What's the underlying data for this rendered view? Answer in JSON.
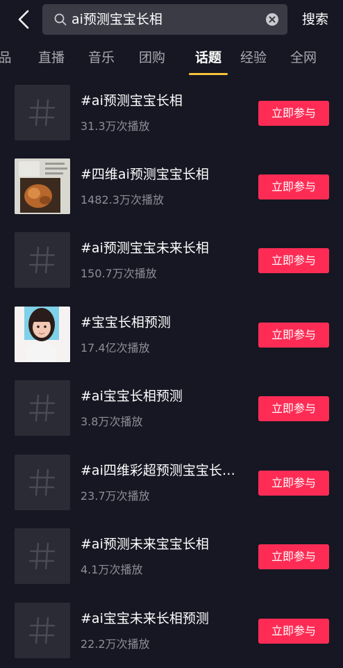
{
  "search": {
    "query": "ai预测宝宝长相",
    "submit_label": "搜索"
  },
  "tabs": [
    {
      "label": "品"
    },
    {
      "label": "直播"
    },
    {
      "label": "音乐"
    },
    {
      "label": "团购"
    },
    {
      "label": "话题",
      "active": true
    },
    {
      "label": "经验"
    },
    {
      "label": "全网"
    }
  ],
  "colors": {
    "accent": "#fe2c55",
    "tab_underline": "#f7c33d",
    "background": "#161722"
  },
  "results": [
    {
      "title": "#ai预测宝宝长相",
      "plays": "31.3万次播放",
      "thumb": "hashtag-icon",
      "button": "立即参与"
    },
    {
      "title": "#四维ai预测宝宝长相",
      "plays": "1482.3万次播放",
      "thumb": "ultrasound-photo",
      "button": "立即参与"
    },
    {
      "title": "#ai预测宝宝未来长相",
      "plays": "150.7万次播放",
      "thumb": "hashtag-icon",
      "button": "立即参与"
    },
    {
      "title": "#宝宝长相预测",
      "plays": "17.4亿次播放",
      "thumb": "child-portrait-photo",
      "button": "立即参与"
    },
    {
      "title": "#ai宝宝长相预测",
      "plays": "3.8万次播放",
      "thumb": "hashtag-icon",
      "button": "立即参与"
    },
    {
      "title": "#ai四维彩超预测宝宝长…",
      "plays": "23.7万次播放",
      "thumb": "hashtag-icon",
      "button": "立即参与"
    },
    {
      "title": "#ai预测未来宝宝长相",
      "plays": "4.1万次播放",
      "thumb": "hashtag-icon",
      "button": "立即参与"
    },
    {
      "title": "#ai宝宝未来长相预测",
      "plays": "22.2万次播放",
      "thumb": "hashtag-icon",
      "button": "立即参与"
    }
  ]
}
